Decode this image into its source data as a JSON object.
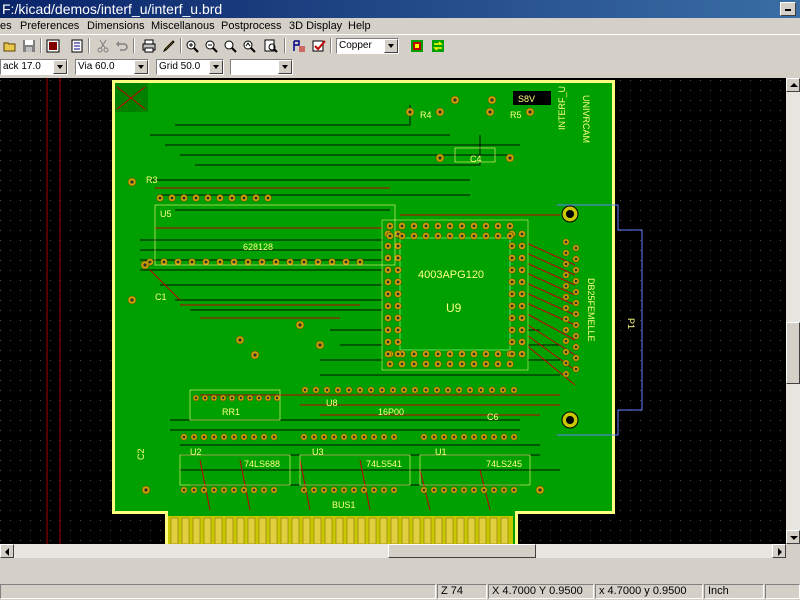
{
  "window": {
    "title": "F:/kicad/demos/interf_u/interf_u.brd"
  },
  "menu": [
    "es",
    "Preferences",
    "Dimensions",
    "Miscellanous",
    "Postprocess",
    "3D Display",
    "Help"
  ],
  "toolbar": {
    "icons": [
      "open-folder-icon",
      "save-icon",
      "board-icon",
      "layers-icon",
      "cut-icon",
      "undo-icon",
      "print-icon",
      "pencil-icon",
      "zoom-in-icon",
      "zoom-out-icon",
      "zoom-fit-icon",
      "zoom-redraw-icon",
      "net-highlight-icon",
      "drc-check-icon",
      "select-layer-icon",
      "switch-layer-icon"
    ],
    "layer_select": "Copper"
  },
  "options_bar": {
    "track": "ack 17.0",
    "via": "Via 60.0",
    "grid": "Grid 50.0",
    "zoom": ""
  },
  "board": {
    "labels": [
      "S8V",
      "R4",
      "R5",
      "C4",
      "R3",
      "U5",
      "628128",
      "C1",
      "4003APG120",
      "U9",
      "P1",
      "DB25FEMELLE",
      "INTERF_U",
      "UNIVRCAM",
      "RR1",
      "U8",
      "16P00",
      "C6",
      "74LS688",
      "74LS541",
      "74LS245",
      "U2",
      "U1",
      "U3",
      "C2",
      "BUS1"
    ]
  },
  "status": {
    "zoom": "Z 74",
    "abs_coords": "X 4.7000  Y 0.9500",
    "rel_coords": "x 4.7000  y 0.9500",
    "units": "Inch"
  }
}
